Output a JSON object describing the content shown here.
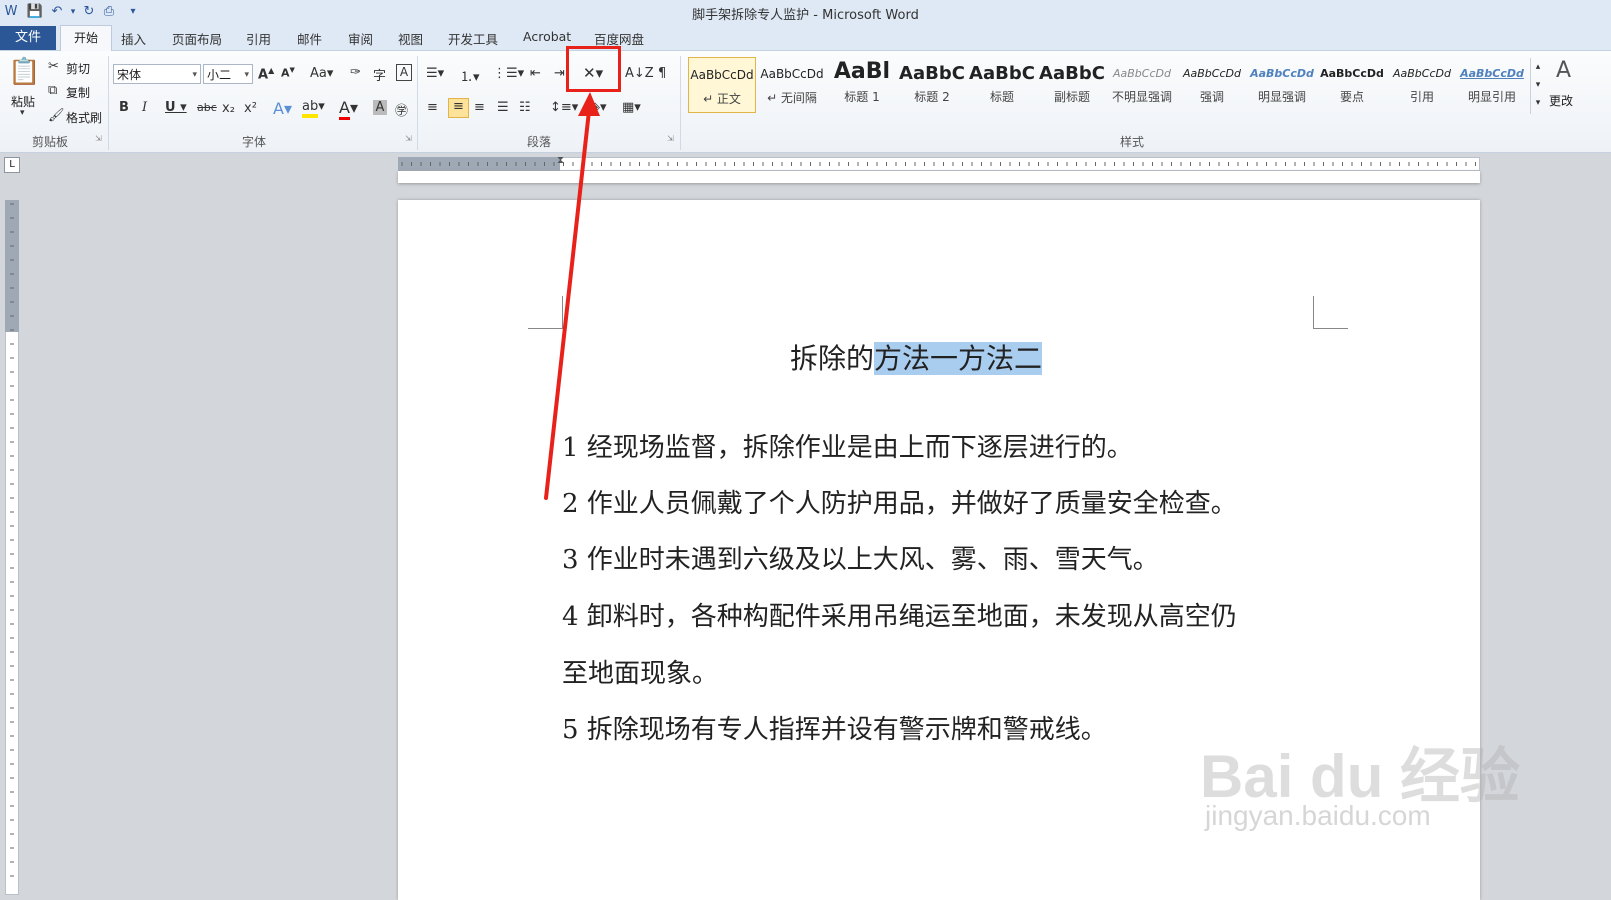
{
  "window": {
    "title": "脚手架拆除专人监护 - Microsoft Word"
  },
  "tabs": {
    "file": "文件",
    "home": "开始",
    "insert": "插入",
    "layout": "页面布局",
    "references": "引用",
    "mailings": "邮件",
    "review": "审阅",
    "view": "视图",
    "developer": "开发工具",
    "acrobat": "Acrobat",
    "baidu": "百度网盘"
  },
  "clipboard": {
    "paste": "粘贴",
    "cut": "剪切",
    "copy": "复制",
    "format_painter": "格式刷",
    "label": "剪贴板"
  },
  "font": {
    "name": "宋体",
    "size": "小二",
    "label": "字体"
  },
  "paragraph": {
    "label": "段落"
  },
  "styles": {
    "label": "样式",
    "change": "更改",
    "items": [
      {
        "sample": "AaBbCcDd",
        "name": "↵ 正文"
      },
      {
        "sample": "AaBbCcDd",
        "name": "↵ 无间隔"
      },
      {
        "sample": "AaBl",
        "name": "标题 1"
      },
      {
        "sample": "AaBbC",
        "name": "标题 2"
      },
      {
        "sample": "AaBbC",
        "name": "标题"
      },
      {
        "sample": "AaBbC",
        "name": "副标题"
      },
      {
        "sample": "AaBbCcDd",
        "name": "不明显强调"
      },
      {
        "sample": "AaBbCcDd",
        "name": "强调"
      },
      {
        "sample": "AaBbCcDd",
        "name": "明显强调"
      },
      {
        "sample": "AaBbCcDd",
        "name": "要点"
      },
      {
        "sample": "AaBbCcDd",
        "name": "引用"
      },
      {
        "sample": "AaBbCcDd",
        "name": "明显引用"
      }
    ]
  },
  "document": {
    "title_plain": "拆除的",
    "title_selected": "方法一方法二",
    "paragraphs": [
      "1 经现场监督，拆除作业是由上而下逐层进行的。",
      "2 作业人员佩戴了个人防护用品，并做好了质量安全检查。",
      "3 作业时未遇到六级及以上大风、雾、雨、雪天气。",
      "4  卸料时，各种构配件采用吊绳运至地面，未发现从高空仍",
      "至地面现象。",
      "5 拆除现场有专人指挥并设有警示牌和警戒线。"
    ]
  },
  "watermark": {
    "brand": "Bai du 经验",
    "url": "jingyan.baidu.com"
  },
  "colors": {
    "accent": "#2b5797",
    "annotation": "#e8221b",
    "selection": "#a9cdef"
  }
}
